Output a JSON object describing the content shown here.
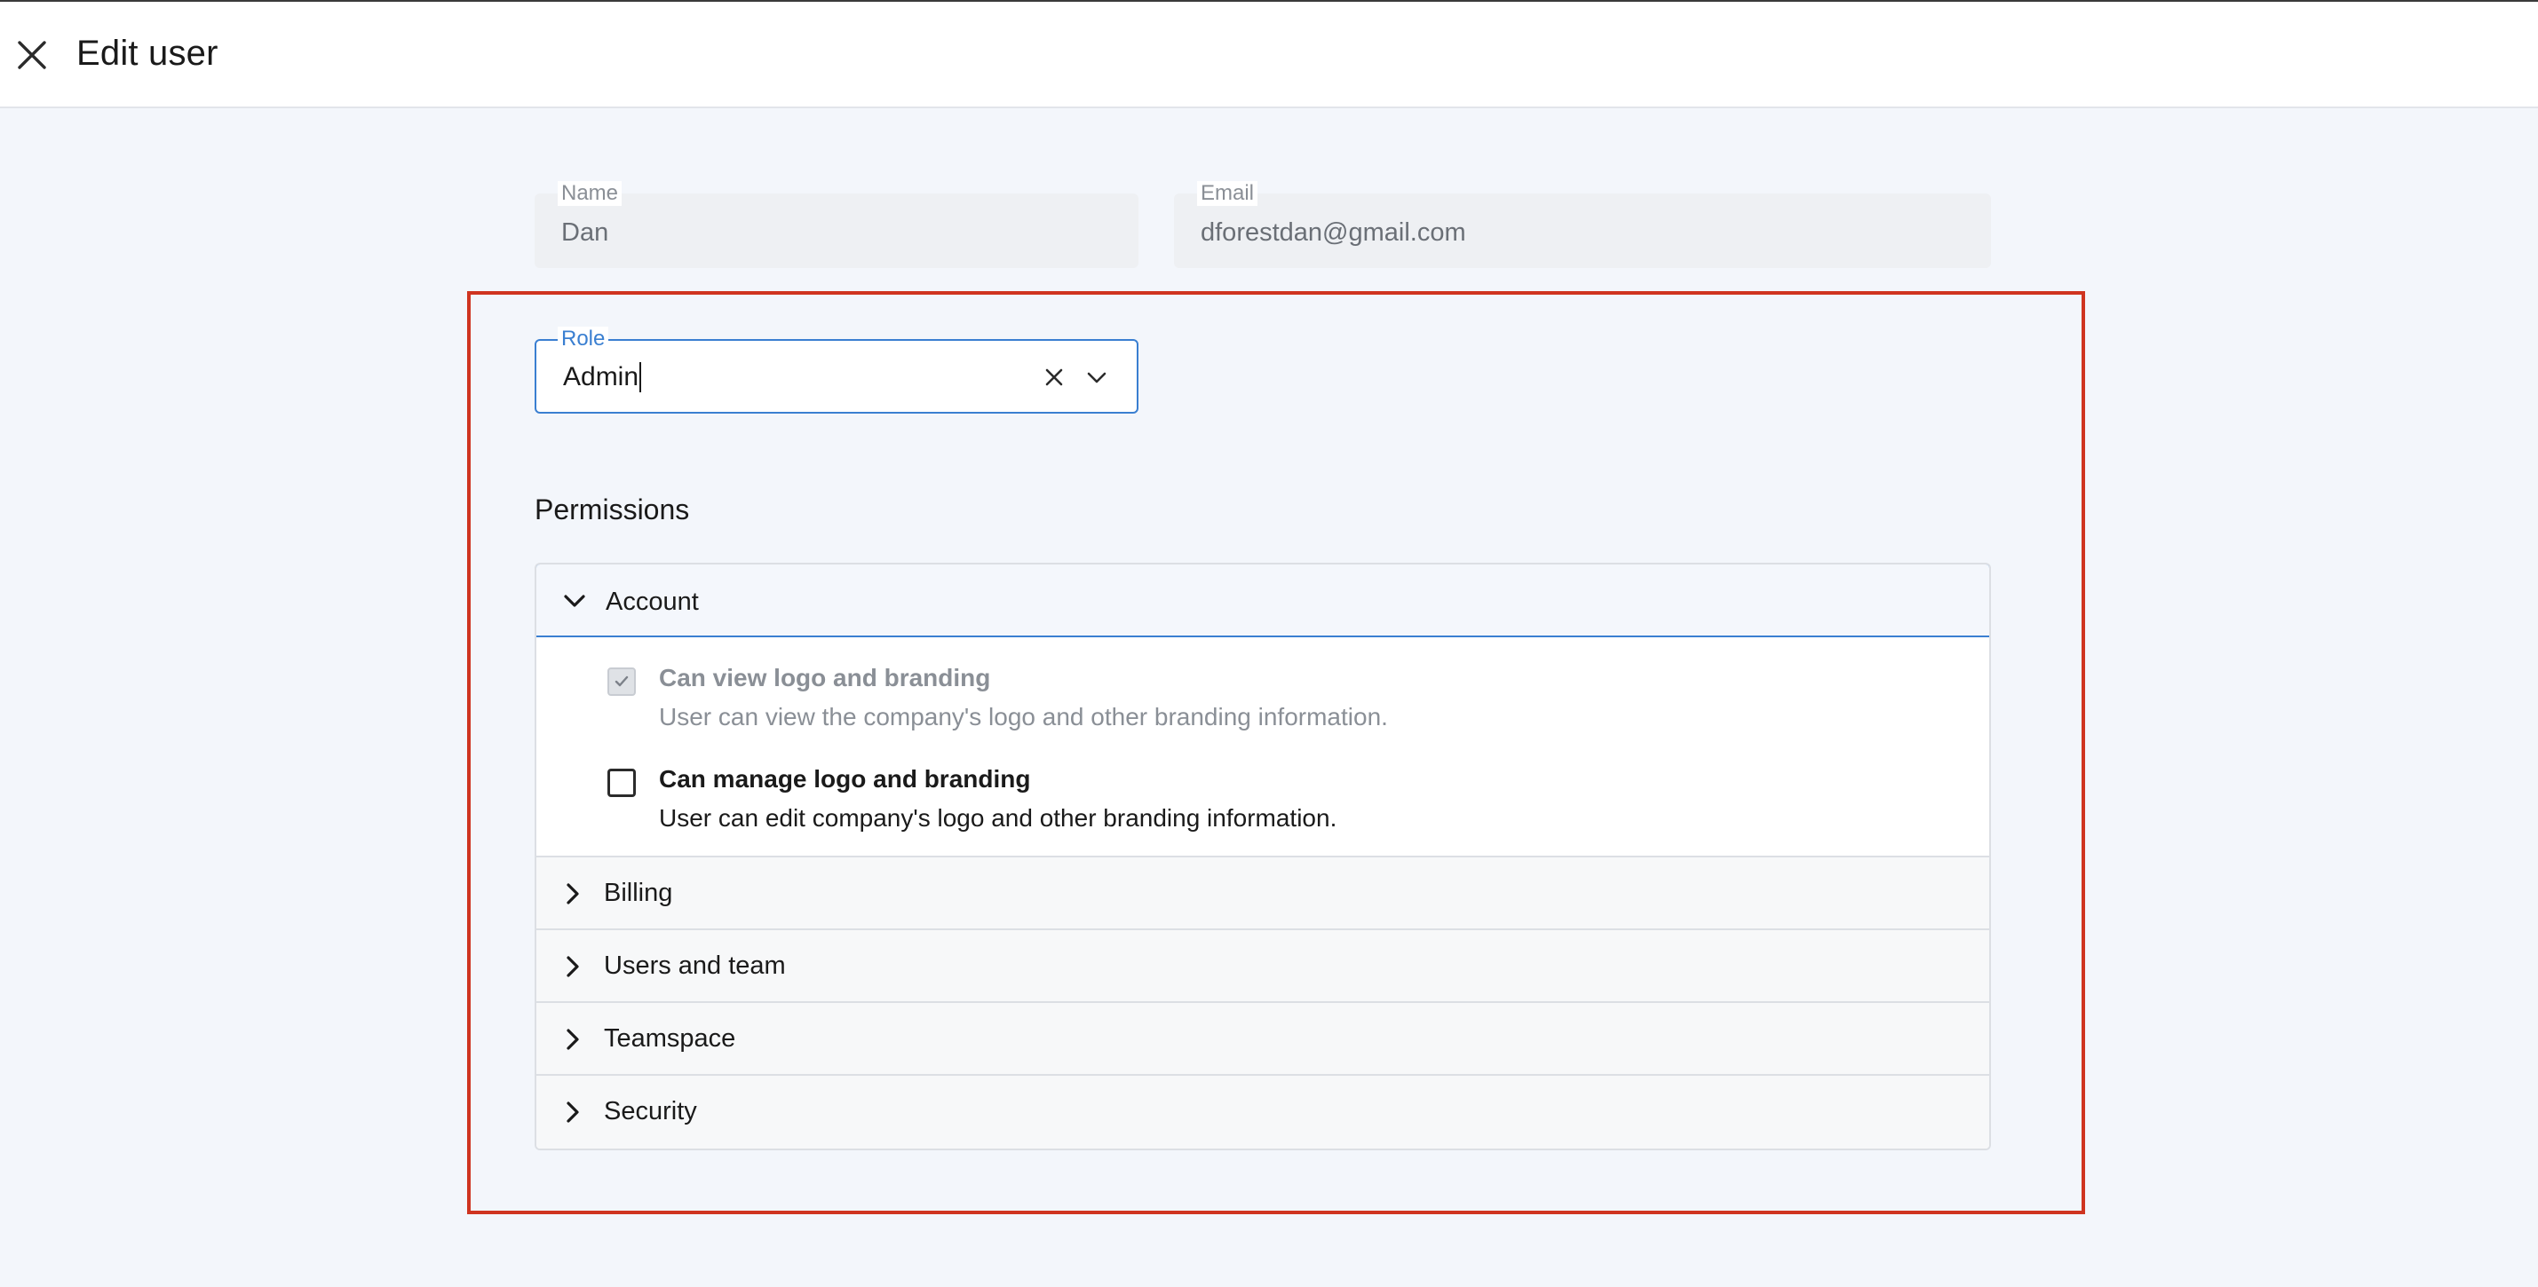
{
  "header": {
    "title": "Edit user",
    "close_icon": "close-icon"
  },
  "form": {
    "name": {
      "label": "Name",
      "value": "Dan"
    },
    "email": {
      "label": "Email",
      "value": "dforestdan@gmail.com"
    },
    "role": {
      "label": "Role",
      "value": "Admin"
    }
  },
  "permissions": {
    "title": "Permissions",
    "sections": [
      {
        "label": "Account",
        "expanded": true,
        "items": [
          {
            "name": "Can view logo and branding",
            "description": "User can view the company's logo and other branding information.",
            "checked": true,
            "disabled": true
          },
          {
            "name": "Can manage logo and branding",
            "description": "User can edit company's logo and other branding information.",
            "checked": false,
            "disabled": false
          }
        ]
      },
      {
        "label": "Billing",
        "expanded": false
      },
      {
        "label": "Users and team",
        "expanded": false
      },
      {
        "label": "Teamspace",
        "expanded": false
      },
      {
        "label": "Security",
        "expanded": false
      }
    ]
  },
  "colors": {
    "accent": "#3a7fd1",
    "highlight": "#cf3420",
    "background": "#f3f6fb"
  }
}
